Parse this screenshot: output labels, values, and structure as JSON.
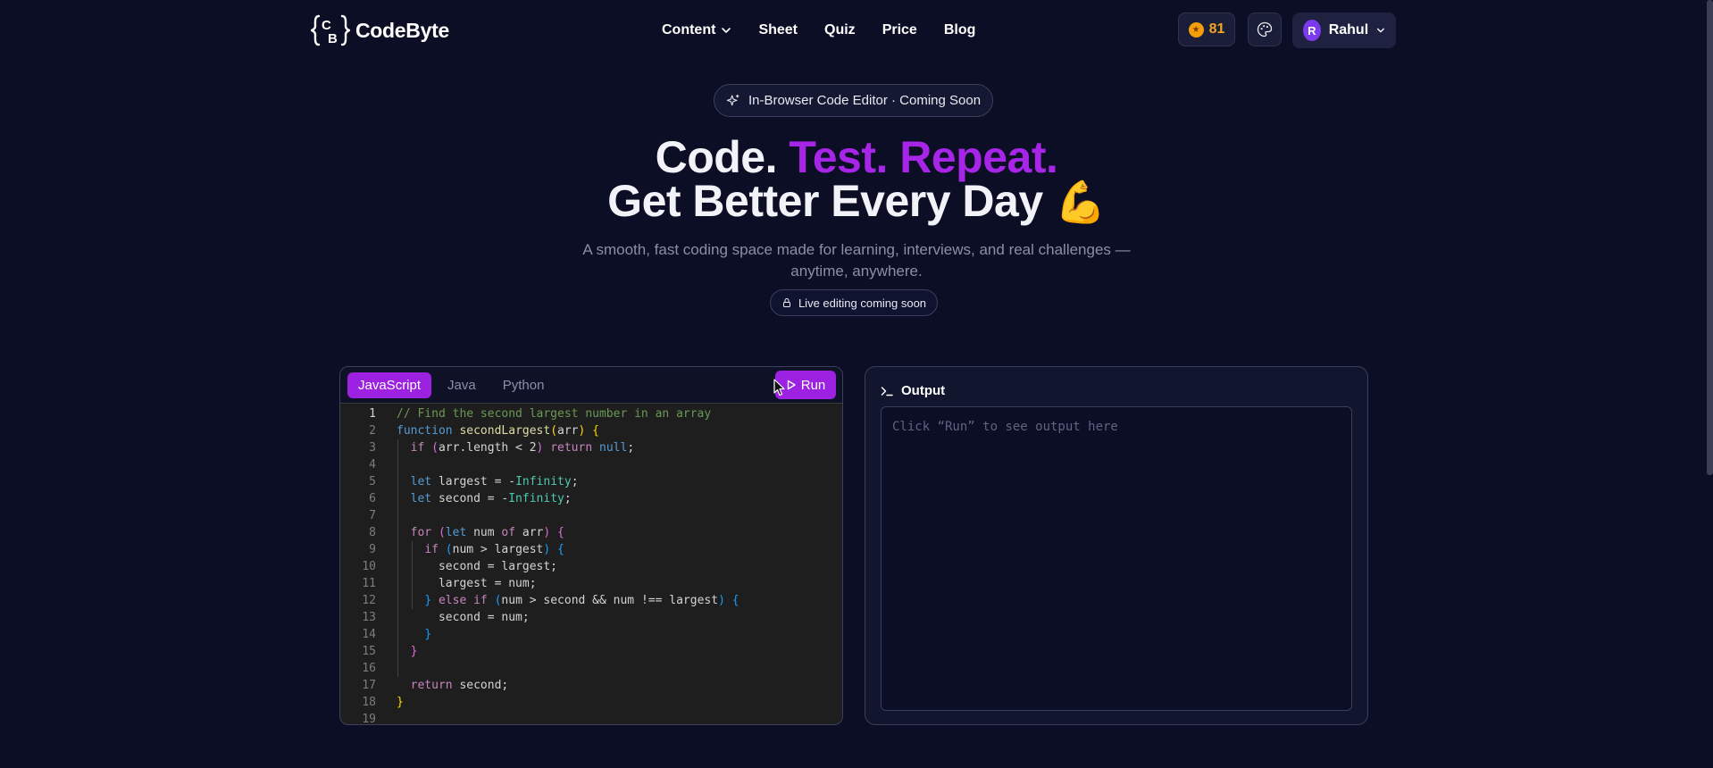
{
  "header": {
    "logo_text": "CodeByte",
    "nav": [
      {
        "label": "Content",
        "has_dropdown": true
      },
      {
        "label": "Sheet"
      },
      {
        "label": "Quiz"
      },
      {
        "label": "Price"
      },
      {
        "label": "Blog"
      }
    ],
    "coins": "81",
    "user": {
      "initial": "R",
      "name": "Rahul"
    }
  },
  "hero": {
    "badge": "In-Browser Code Editor · Coming Soon",
    "title_line1_white": "Code. ",
    "title_line1_purple": "Test. Repeat.",
    "title_line2": "Get Better Every Day ",
    "title_emoji": "💪",
    "subtitle_line1": "A smooth, fast coding space made for learning, interviews, and real challenges —",
    "subtitle_line2": "anytime, anywhere.",
    "live_badge": "Live editing coming soon"
  },
  "editor": {
    "tabs": [
      "JavaScript",
      "Java",
      "Python"
    ],
    "active_tab": "JavaScript",
    "run_label": "Run",
    "line_numbers": [
      "1",
      "2",
      "3",
      "4",
      "5",
      "6",
      "7",
      "8",
      "9",
      "10",
      "11",
      "12",
      "13",
      "14",
      "15",
      "16",
      "17",
      "18",
      "19"
    ],
    "code_lines": [
      "// Find the second largest number in an array",
      "function secondLargest(arr) {",
      "  if (arr.length < 2) return null;",
      "",
      "  let largest = -Infinity;",
      "  let second = -Infinity;",
      "",
      "  for (let num of arr) {",
      "    if (num > largest) {",
      "      second = largest;",
      "      largest = num;",
      "    } else if (num > second && num !== largest) {",
      "      second = num;",
      "    }",
      "  }",
      "",
      "  return second;",
      "}",
      ""
    ]
  },
  "output": {
    "title": "Output",
    "placeholder": "Click “Run” to see output here"
  },
  "colors": {
    "accent": "#a625e6",
    "background": "#0b0e24",
    "coin": "#f5a524"
  }
}
